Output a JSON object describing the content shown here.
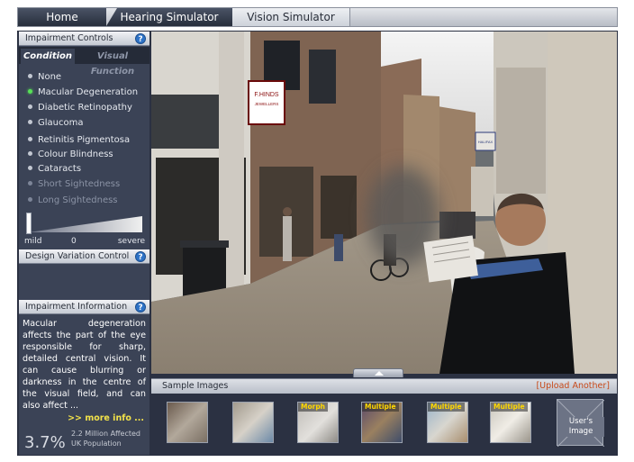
{
  "nav": {
    "tabs": [
      "Home",
      "Hearing Simulator",
      "Vision Simulator"
    ],
    "active": "Vision Simulator"
  },
  "controls": {
    "title": "Impairment Controls",
    "help": "?",
    "subtabs": [
      "Condition",
      "Visual Function"
    ],
    "conditions": [
      {
        "label": "None",
        "state": "normal"
      },
      {
        "label": "Macular Degeneration",
        "state": "active"
      },
      {
        "label": "Diabetic Retinopathy",
        "state": "normal"
      },
      {
        "label": "Glaucoma",
        "state": "normal"
      },
      {
        "label": "Retinitis Pigmentosa",
        "state": "normal"
      },
      {
        "label": "Colour Blindness",
        "state": "normal"
      },
      {
        "label": "Cataracts",
        "state": "normal"
      },
      {
        "label": "Short Sightedness",
        "state": "disabled"
      },
      {
        "label": "Long Sightedness",
        "state": "disabled"
      }
    ],
    "slider": {
      "min_label": "mild",
      "max_label": "severe",
      "value_label": "0",
      "value": 0
    }
  },
  "design": {
    "title": "Design Variation Control",
    "help": "?"
  },
  "info": {
    "title": "Impairment Information",
    "help": "?",
    "text": "Macular degeneration affects the part of the eye responsible for sharp, detailed central vision. It can cause blurring or darkness in the centre of the visual field, and can also affect ...",
    "more": ">> more info ...",
    "stat_percent": "3.7%",
    "stat_line1": "2.2  Million Affected",
    "stat_line2": "UK Population"
  },
  "samples": {
    "title": "Sample Images",
    "upload": "[Upload Another]",
    "thumbs": [
      {
        "name": "street",
        "tag": ""
      },
      {
        "name": "documents",
        "tag": ""
      },
      {
        "name": "printer",
        "tag": "Morph"
      },
      {
        "name": "shelf",
        "tag": "Multiple"
      },
      {
        "name": "map",
        "tag": "Multiple"
      },
      {
        "name": "newspaper",
        "tag": "Multiple"
      }
    ],
    "user_image_line1": "User's",
    "user_image_line2": "Image"
  },
  "scene": {
    "shop_sign": "F.HINDS",
    "shop_sign_sub": "JEWELLERS",
    "hanging_sign": "HALIFAX"
  },
  "colors": {
    "panel": "#3b4356",
    "frame": "#2b3142",
    "accent_active": "#57e057",
    "more_info": "#f2e24a",
    "upload": "#c84a1a",
    "help": "#2e73c7"
  }
}
